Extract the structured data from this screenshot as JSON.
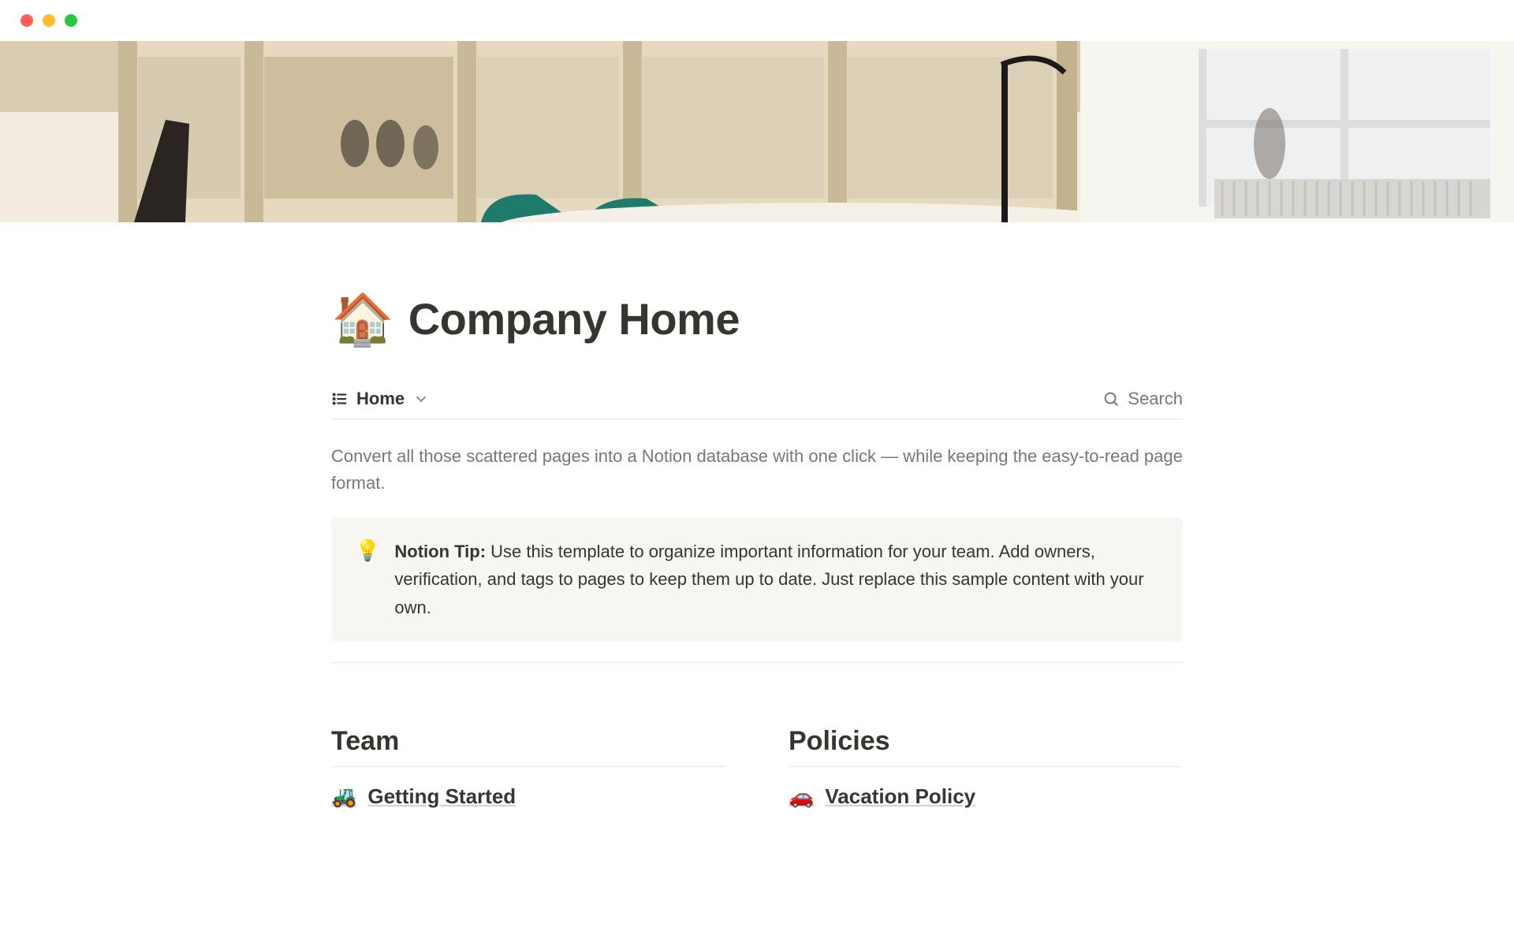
{
  "page": {
    "emoji": "🏠",
    "title": "Company Home"
  },
  "view": {
    "name": "Home",
    "search_label": "Search"
  },
  "description": "Convert all those scattered pages into a Notion database with one click — while keeping the easy-to-read page format.",
  "callout": {
    "icon": "💡",
    "label": "Notion Tip:",
    "body": " Use this template to organize important information for your team. Add owners, verification, and tags to pages to keep them up to date. Just replace this sample content with your own."
  },
  "sections": [
    {
      "title": "Team",
      "links": [
        {
          "emoji": "🚜",
          "label": "Getting Started"
        }
      ]
    },
    {
      "title": "Policies",
      "links": [
        {
          "emoji": "🚗",
          "label": "Vacation Policy"
        }
      ]
    }
  ]
}
